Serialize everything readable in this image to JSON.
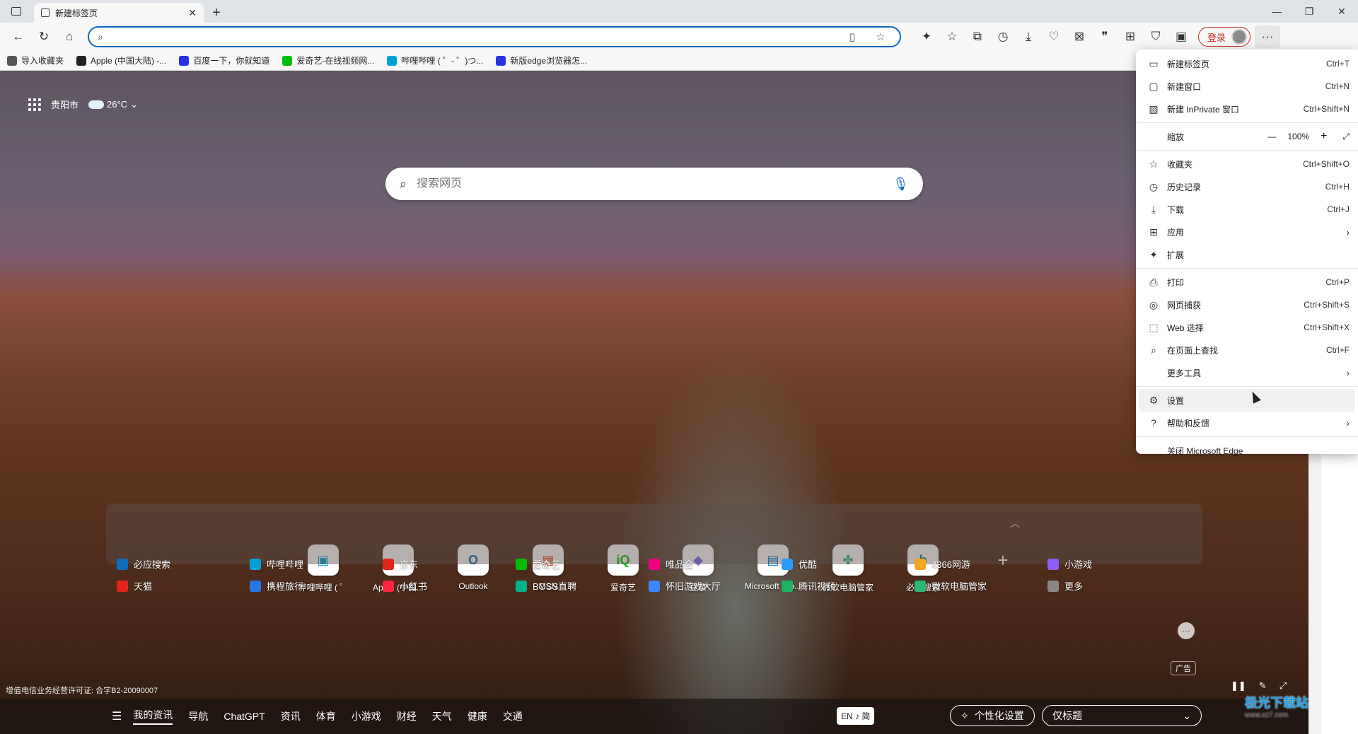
{
  "tab": {
    "title": "新建标签页"
  },
  "address": {
    "value": "",
    "placeholder": ""
  },
  "toolbar": {
    "login_label": "登录"
  },
  "favorites": [
    {
      "label": "导入收藏夹",
      "color": "#555555"
    },
    {
      "label": "Apple (中国大陆) -...",
      "color": "#222222"
    },
    {
      "label": "百度一下，你就知道",
      "color": "#2932e1"
    },
    {
      "label": "爱奇艺-在线视频网...",
      "color": "#00be06"
    },
    {
      "label": "哔哩哔哩 ( ゜- ゜)つ...",
      "color": "#00a1d6"
    },
    {
      "label": "新版edge浏览器怎...",
      "color": "#2932e1"
    }
  ],
  "ntp": {
    "city": "贵阳市",
    "temperature": "26°C",
    "search_placeholder": "搜索网页",
    "quicklinks": [
      {
        "label": "哔哩哔哩 ( ゜",
        "glyph": "▣",
        "color": "#00a1d6"
      },
      {
        "label": "Apple (中国...",
        "glyph": "",
        "color": "#111111"
      },
      {
        "label": "Outlook",
        "glyph": "O",
        "color": "#0f6cbd"
      },
      {
        "label": "MSN",
        "glyph": "▦",
        "color": "#f25022"
      },
      {
        "label": "爱奇艺",
        "glyph": "iQ",
        "color": "#00be06"
      },
      {
        "label": "登录",
        "glyph": "◆",
        "color": "#7b61ff"
      },
      {
        "label": "Microsoft Sto...",
        "glyph": "▤",
        "color": "#0078d4"
      },
      {
        "label": "微软电脑管家",
        "glyph": "✤",
        "color": "#2bb673"
      },
      {
        "label": "必应搜索",
        "glyph": "b",
        "color": "#008373"
      }
    ],
    "links_row1": [
      {
        "label": "必应搜索",
        "color": "#0f6cbd"
      },
      {
        "label": "哔哩哔哩",
        "color": "#00a1d6"
      },
      {
        "label": "京东",
        "color": "#e1251b"
      },
      {
        "label": "爱奇艺",
        "color": "#00be06"
      },
      {
        "label": "唯品会",
        "color": "#f10180"
      },
      {
        "label": "优酷",
        "color": "#2b9cfa"
      },
      {
        "label": "4366网游",
        "color": "#f5a623"
      },
      {
        "label": "小游戏",
        "color": "#8e5cf7"
      }
    ],
    "links_row2": [
      {
        "label": "天猫",
        "color": "#e1251b"
      },
      {
        "label": "携程旅行",
        "color": "#2577e3"
      },
      {
        "label": "小红书",
        "color": "#ff2442"
      },
      {
        "label": "BOSS直聘",
        "color": "#00b38a"
      },
      {
        "label": "怀旧游戏大厅",
        "color": "#3a86ff"
      },
      {
        "label": "腾讯视频",
        "color": "#1fb264"
      },
      {
        "label": "微软电脑管家",
        "color": "#2bb673"
      },
      {
        "label": "更多",
        "color": "#888888"
      }
    ],
    "ad_tag": "广告",
    "license": "增值电信业务经营许可证: 合字B2-20090007",
    "nav": [
      "我的资讯",
      "导航",
      "ChatGPT",
      "资讯",
      "体育",
      "小游戏",
      "财经",
      "天气",
      "健康",
      "交通"
    ],
    "lang": "EN ♪ 简",
    "personalize": "个性化设置",
    "headline_mode": "仅标题",
    "watermark": "极光下载站",
    "watermark_sub": "www.xz7.com"
  },
  "menu": {
    "new_tab": {
      "label": "新建标签页",
      "shortcut": "Ctrl+T"
    },
    "new_window": {
      "label": "新建窗口",
      "shortcut": "Ctrl+N"
    },
    "new_inprivate": {
      "label": "新建 InPrivate 窗口",
      "shortcut": "Ctrl+Shift+N"
    },
    "zoom": {
      "label": "缩放",
      "value": "100%"
    },
    "favorites": {
      "label": "收藏夹",
      "shortcut": "Ctrl+Shift+O"
    },
    "history": {
      "label": "历史记录",
      "shortcut": "Ctrl+H"
    },
    "downloads": {
      "label": "下载",
      "shortcut": "Ctrl+J"
    },
    "apps": {
      "label": "应用"
    },
    "extensions": {
      "label": "扩展"
    },
    "print": {
      "label": "打印",
      "shortcut": "Ctrl+P"
    },
    "capture": {
      "label": "网页捕获",
      "shortcut": "Ctrl+Shift+S"
    },
    "web_select": {
      "label": "Web 选择",
      "shortcut": "Ctrl+Shift+X"
    },
    "find": {
      "label": "在页面上查找",
      "shortcut": "Ctrl+F"
    },
    "more_tools": {
      "label": "更多工具"
    },
    "settings": {
      "label": "设置"
    },
    "help": {
      "label": "帮助和反馈"
    },
    "close_edge": {
      "label": "关闭 Microsoft Edge"
    }
  }
}
